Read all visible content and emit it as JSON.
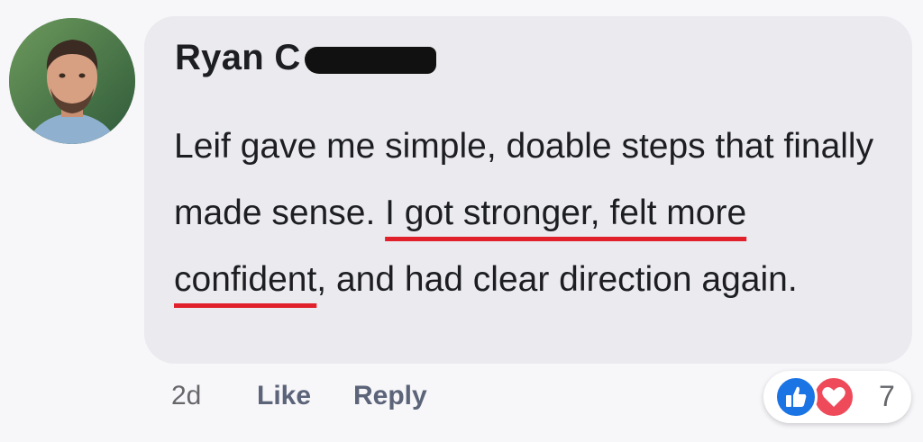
{
  "comment": {
    "author": "Ryan C",
    "text_before": "Leif gave me simple, doable steps that finally made sense. ",
    "highlight_text": "I got stronger, felt more confident",
    "text_after": ", and had clear direction again."
  },
  "meta": {
    "time": "2d",
    "like_label": "Like",
    "reply_label": "Reply"
  },
  "reactions": {
    "icons": [
      "thumbs-up-icon",
      "heart-icon"
    ],
    "count": "7",
    "like_color": "#1b74e4",
    "love_color": "#ee4a5a"
  },
  "colors": {
    "highlight_underline": "#e0202b",
    "bubble_bg": "#ebeaee"
  }
}
